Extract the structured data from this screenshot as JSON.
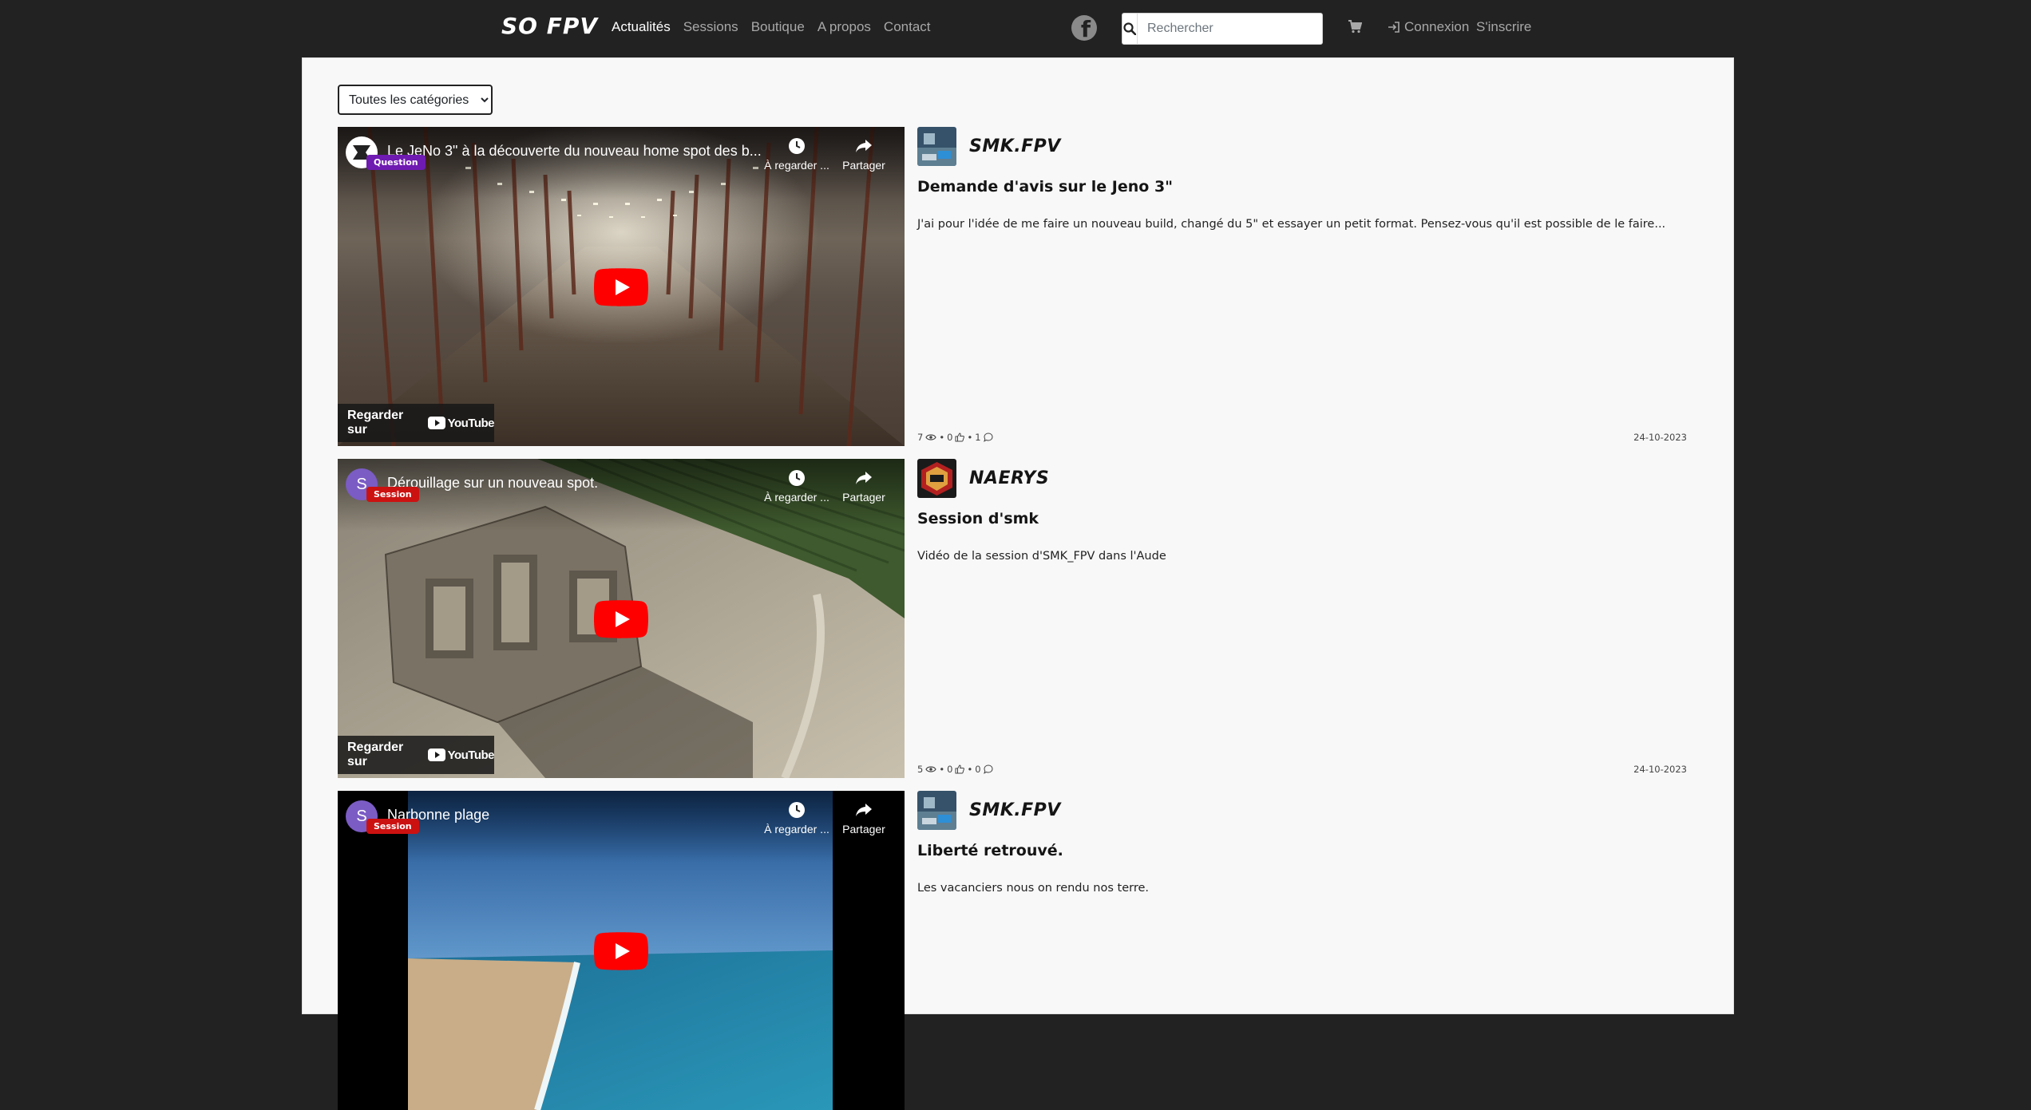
{
  "nav": {
    "brand": "SO FPV",
    "links": [
      {
        "label": "Actualités",
        "active": true
      },
      {
        "label": "Sessions"
      },
      {
        "label": "Boutique"
      },
      {
        "label": "A propos"
      },
      {
        "label": "Contact"
      }
    ],
    "search_placeholder": "Rechercher",
    "login": "Connexion",
    "signup": "S'inscrire",
    "icons": [
      "facebook-icon",
      "search-icon",
      "cart-icon",
      "login-icon"
    ]
  },
  "filter": {
    "selected": "Toutes les catégories"
  },
  "posts": [
    {
      "video_title": "Le JeNo 3\" à la découverte du nouveau home spot des b...",
      "badge": "Question",
      "watch_later": "À regarder ...",
      "share": "Partager",
      "watch_on": "Regarder sur",
      "yt_label": "YouTube",
      "author": "SMK.FPV",
      "title": "Demande d'avis sur le Jeno 3\"",
      "excerpt": "J'ai pour l'idée de me faire un nouveau build, changé du 5\" et essayer un petit format. Pensez-vous qu'il est possible de le faire...",
      "views": "7",
      "likes": "0",
      "comments": "1",
      "date": "24-10-2023"
    },
    {
      "video_title": "Dérouillage sur un nouveau spot.",
      "avatar_letter": "S",
      "badge": "Session",
      "watch_later": "À regarder ...",
      "share": "Partager",
      "watch_on": "Regarder sur",
      "yt_label": "YouTube",
      "author": "NAERYS",
      "title": "Session d'smk",
      "excerpt": "Vidéo de la session d'SMK_FPV dans l'Aude",
      "views": "5",
      "likes": "0",
      "comments": "0",
      "date": "24-10-2023"
    },
    {
      "video_title": "Narbonne plage",
      "avatar_letter": "S",
      "badge": "Session",
      "watch_later": "À regarder ...",
      "share": "Partager",
      "author": "SMK.FPV",
      "title": "Liberté retrouvé.",
      "excerpt": "Les vacanciers nous on rendu nos terre."
    }
  ]
}
